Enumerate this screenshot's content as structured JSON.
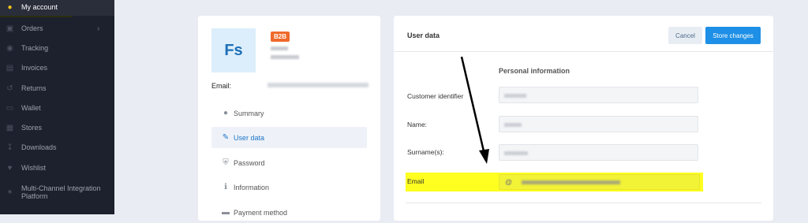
{
  "sidebar": {
    "items": [
      {
        "label": "My account",
        "icon": "user-icon"
      },
      {
        "label": "Orders",
        "icon": "box-icon"
      },
      {
        "label": "Tracking",
        "icon": "location-icon"
      },
      {
        "label": "Invoices",
        "icon": "invoice-icon"
      },
      {
        "label": "Returns",
        "icon": "returns-icon"
      },
      {
        "label": "Wallet",
        "icon": "wallet-icon"
      },
      {
        "label": "Stores",
        "icon": "store-icon"
      },
      {
        "label": "Downloads",
        "icon": "download-icon"
      },
      {
        "label": "Wishlist",
        "icon": "heart-icon"
      },
      {
        "label": "Multi-Channel Integration Platform",
        "icon": "network-icon"
      }
    ]
  },
  "profile": {
    "initials": "Fs",
    "badge": "B2B",
    "email_label": "Email:"
  },
  "menu": {
    "items": [
      {
        "label": "Summary",
        "icon": "user-icon"
      },
      {
        "label": "User data",
        "icon": "edit-icon"
      },
      {
        "label": "Password",
        "icon": "shield-icon"
      },
      {
        "label": "Information",
        "icon": "info-icon"
      },
      {
        "label": "Payment method",
        "icon": "card-icon"
      }
    ]
  },
  "user_data": {
    "title": "User data",
    "cancel_label": "Cancel",
    "store_label": "Store changes",
    "section_title": "Personal information",
    "fields": {
      "customer_identifier": "Customer identifier",
      "name": "Name:",
      "surname": "Surname(s):",
      "email": "Email",
      "email_prefix": "@"
    }
  },
  "colors": {
    "accent": "#1e8fe6",
    "highlight": "#ffff20",
    "badge": "#ef6a2c",
    "sidebar_bg": "#1d212d"
  }
}
